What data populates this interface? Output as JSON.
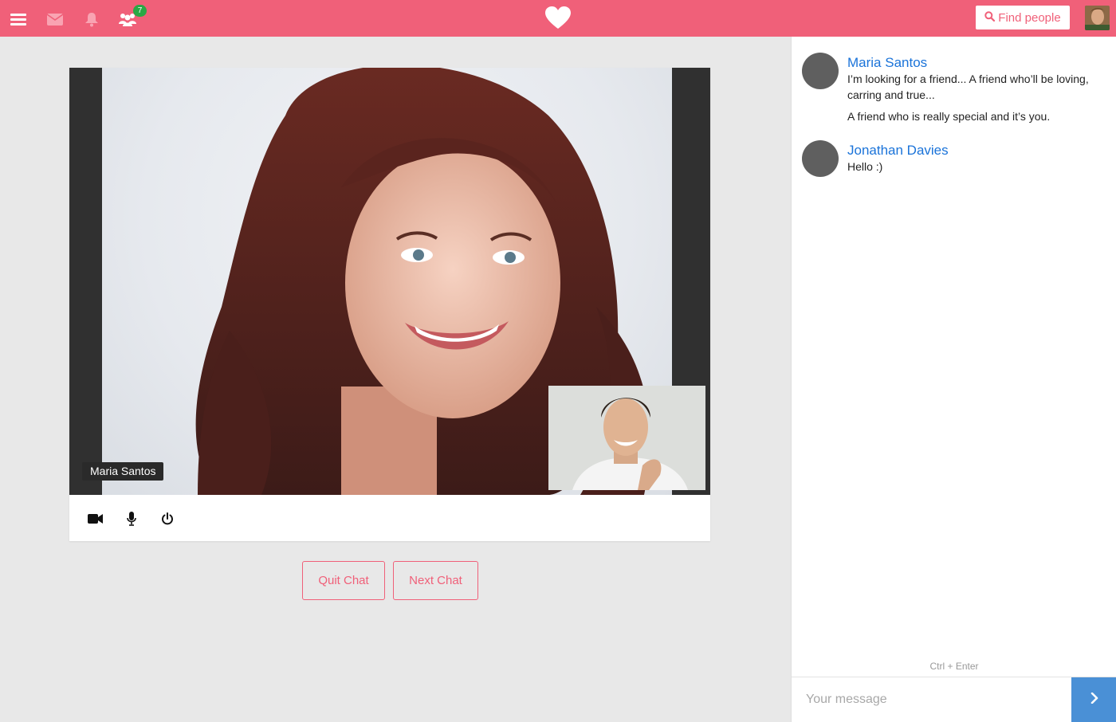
{
  "topbar": {
    "badge_count": "7",
    "find_people_label": "Find people",
    "icons": [
      "menu-icon",
      "envelope-icon",
      "bell-icon",
      "users-icon",
      "heart-logo",
      "search-icon"
    ]
  },
  "video": {
    "remote_name": "Maria Santos",
    "controls": [
      "video-camera-icon",
      "microphone-icon",
      "power-icon"
    ]
  },
  "actions": {
    "quit_label": "Quit Chat",
    "next_label": "Next Chat"
  },
  "chat": {
    "messages": [
      {
        "author": "Maria Santos",
        "lines": [
          "I’m looking for a friend... A friend who’ll be loving, carring and true...",
          "A friend who is really special and it’s you."
        ]
      },
      {
        "author": "Jonathan Davies",
        "lines": [
          "Hello :)"
        ]
      }
    ],
    "hint": "Ctrl + Enter",
    "placeholder": "Your message"
  },
  "colors": {
    "brand": "#f06079",
    "link": "#1a73d9",
    "send": "#4a90d6",
    "badge": "#2aa845"
  }
}
